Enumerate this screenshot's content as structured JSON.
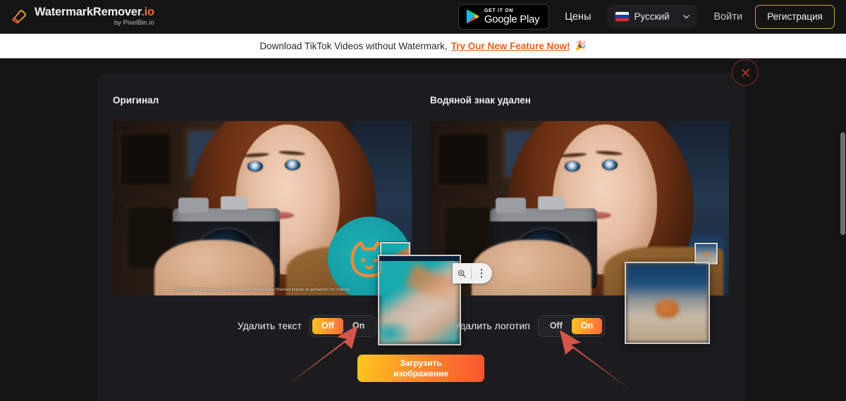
{
  "brand": {
    "title": "WatermarkRemover",
    "tld": ".io",
    "subtitle": "by PixelBin.io",
    "logo_icon": "eraser-logo-icon"
  },
  "nav": {
    "google_play": {
      "small": "GET IT ON",
      "big": "Google Play",
      "icon": "google-play-icon"
    },
    "pricing": "Цены",
    "language": {
      "value": "Русский",
      "flag": "russia-flag-icon",
      "chevron": "chevron-down-icon"
    },
    "signin": "Войти",
    "signup": "Регистрация"
  },
  "announcement": {
    "text": "Download TikTok Videos without Watermark,",
    "link": "Try Our New Feature Now!",
    "emoji": "🎉"
  },
  "card": {
    "close_icon": "close-icon",
    "panels": {
      "original_title": "Оригинал",
      "result_title": "Водяной знак удален"
    },
    "watermark_overlay_text": "Обработано с помощью бесплатной версии Watermarkly. Платная версия не добавляет эту отметку",
    "controls": [
      {
        "label": "Удалить текст",
        "options": [
          "Off",
          "On"
        ],
        "selected": "Off"
      },
      {
        "label": "Удалить логотип",
        "options": [
          "Off",
          "On"
        ],
        "selected": "On"
      }
    ],
    "upload_button": {
      "line1": "Загрузить",
      "line2": "изображение"
    }
  },
  "overlays": {
    "image_toolbar": {
      "lens_icon": "google-lens-icon",
      "kebab_icon": "more-options-icon"
    },
    "magnifier_left": "zoom-preview-left",
    "magnifier_right": "zoom-preview-right",
    "arrow_left": "annotation-arrow-left",
    "arrow_right": "annotation-arrow-right"
  },
  "colors": {
    "accent_orange": "#f9552f",
    "accent_yellow": "#fdc61f",
    "link_orange": "#e8601c",
    "annotation_red": "#d4564a",
    "page_bg": "#141415",
    "card_bg": "#1c1c1e"
  }
}
